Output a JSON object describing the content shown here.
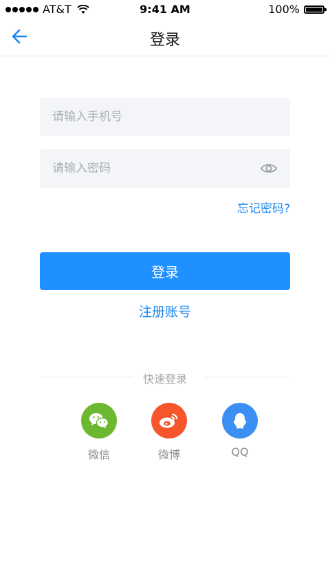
{
  "status_bar": {
    "carrier": "AT&T",
    "time": "9:41 AM",
    "battery": "100%",
    "battery_level": 1.0
  },
  "nav": {
    "title": "登录",
    "back_icon": "arrow-left-icon"
  },
  "form": {
    "phone_placeholder": "请输入手机号",
    "phone_value": "",
    "password_placeholder": "请输入密码",
    "password_value": "",
    "eye_icon": "eye-icon",
    "forgot_label": "忘记密码?",
    "login_label": "登录",
    "register_label": "注册账号"
  },
  "quick_login": {
    "title": "快速登录",
    "providers": [
      {
        "label": "微信",
        "icon": "wechat-icon",
        "color": "#6db831"
      },
      {
        "label": "微博",
        "icon": "weibo-icon",
        "color": "#f5562c"
      },
      {
        "label": "QQ",
        "icon": "qq-icon",
        "color": "#3b8ff2"
      }
    ]
  },
  "colors": {
    "accent": "#1e90ff",
    "link": "#1a86f0",
    "input_bg": "#f4f5f8"
  }
}
